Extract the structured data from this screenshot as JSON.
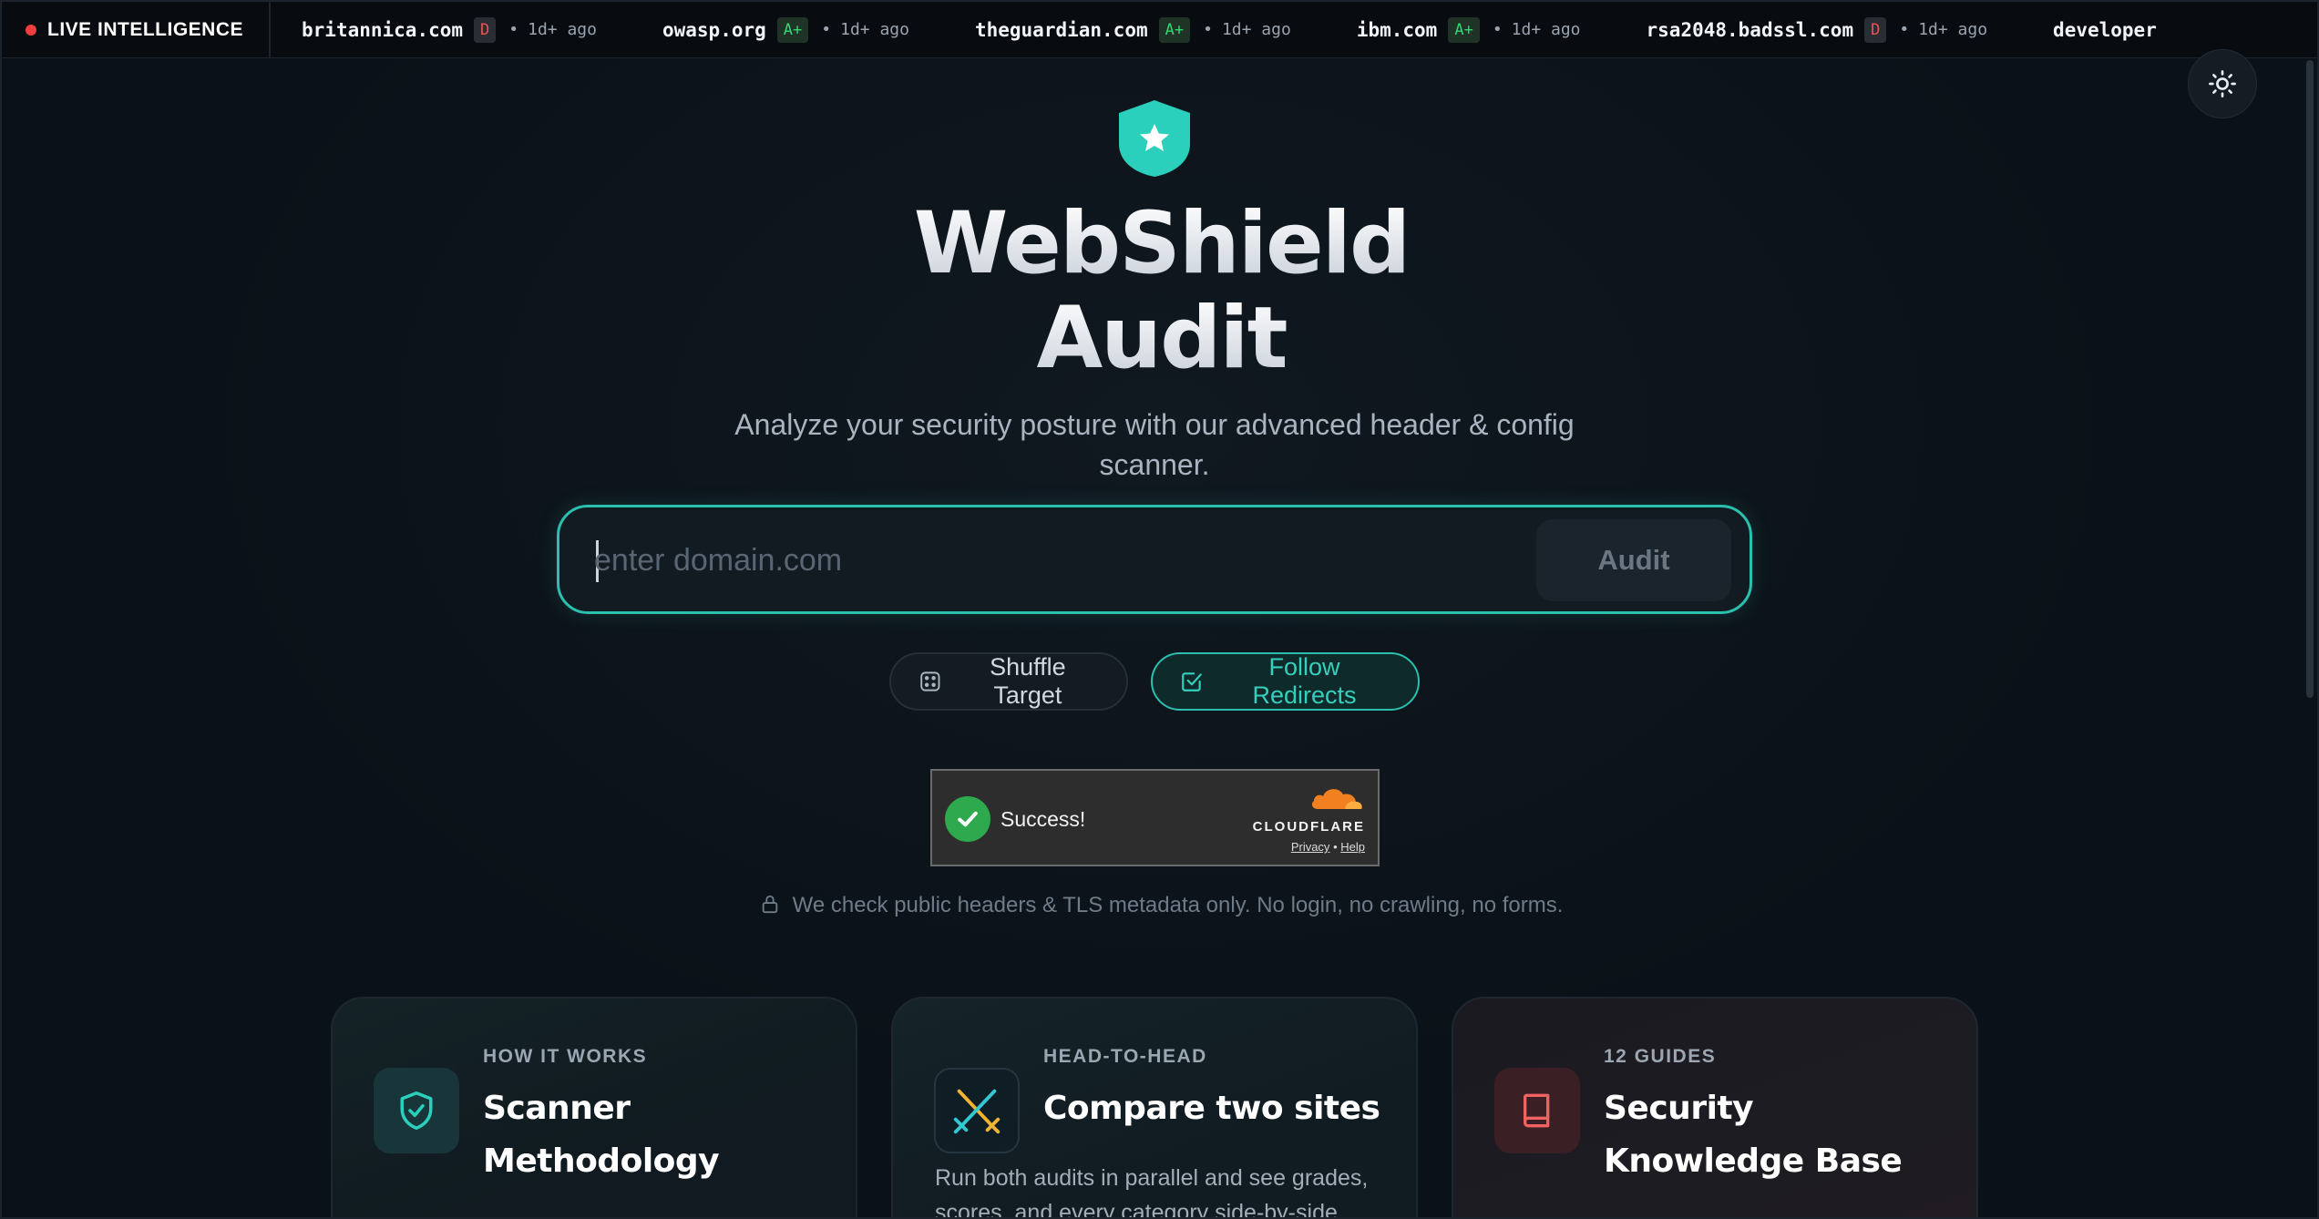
{
  "ticker": {
    "live_label": "LIVE INTELLIGENCE",
    "items": [
      {
        "domain": "britannica.com",
        "grade": "D",
        "status": "bad",
        "time": "1d+ ago"
      },
      {
        "domain": "owasp.org",
        "grade": "A+",
        "status": "good",
        "time": "1d+ ago"
      },
      {
        "domain": "theguardian.com",
        "grade": "A+",
        "status": "good",
        "time": "1d+ ago"
      },
      {
        "domain": "ibm.com",
        "grade": "A+",
        "status": "good",
        "time": "1d+ ago"
      },
      {
        "domain": "rsa2048.badssl.com",
        "grade": "D",
        "status": "bad",
        "time": "1d+ ago"
      },
      {
        "domain": "developer",
        "grade": "",
        "status": "",
        "time": ""
      }
    ]
  },
  "theme_toggle_icon": "sun-icon",
  "hero": {
    "logo_icon": "shield-star-icon",
    "title_line1": "WebShield",
    "title_line2": "Audit",
    "subtitle": "Analyze your security posture with our advanced header & config scanner."
  },
  "search": {
    "placeholder": "enter domain.com",
    "value": "",
    "button_label": "Audit"
  },
  "options": {
    "shuffle_label": "Shuffle Target",
    "shuffle_icon": "dice-icon",
    "follow_label": "Follow Redirects",
    "follow_icon": "checkbox-checked-icon",
    "follow_active": true
  },
  "captcha": {
    "status_text": "Success!",
    "brand": "CLOUDFLARE",
    "privacy_link": "Privacy",
    "separator": "•",
    "help_link": "Help"
  },
  "notice": {
    "icon": "lock-icon",
    "text": "We check public headers & TLS metadata only. No login, no crawling, no forms."
  },
  "cards": [
    {
      "kicker": "HOW IT WORKS",
      "title": "Scanner Methodology",
      "description": "",
      "icon": "shield-check-icon"
    },
    {
      "kicker": "HEAD-TO-HEAD",
      "title": "Compare two sites",
      "description": "Run both audits in parallel and see grades, scores, and every category side-by-side.",
      "icon": "crossed-swords-icon"
    },
    {
      "kicker": "12 GUIDES",
      "title": "Security Knowledge Base",
      "description": "",
      "icon": "book-icon"
    }
  ],
  "colors": {
    "accent": "#2bbfae",
    "grade_bad": "#f05252",
    "grade_good": "#34d672",
    "background": "#0b1118"
  }
}
